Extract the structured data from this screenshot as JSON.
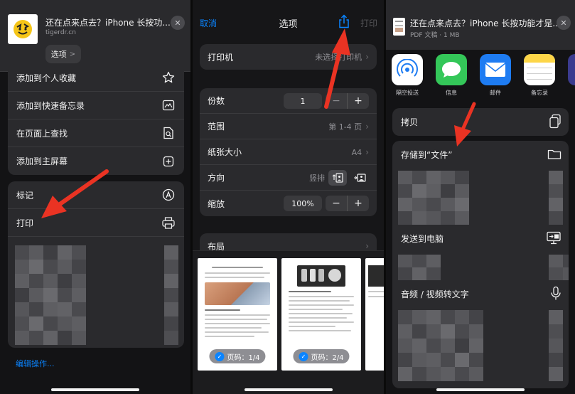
{
  "panel1": {
    "site_title": "还在点来点去？iPhone 长按功...",
    "site_url": "tigerdr.cn",
    "options_label": "选项",
    "options_chevron": ">",
    "close_glyph": "✕",
    "menu_top": [
      {
        "label": "添加到个人收藏",
        "icon": "star-icon"
      },
      {
        "label": "添加到快速备忘录",
        "icon": "quick-note-icon"
      },
      {
        "label": "在页面上查找",
        "icon": "find-in-page-icon"
      },
      {
        "label": "添加到主屏幕",
        "icon": "add-square-icon"
      }
    ],
    "menu_bottom": [
      {
        "label": "标记",
        "icon": "markup-icon"
      },
      {
        "label": "打印",
        "icon": "printer-icon"
      }
    ],
    "edit_actions": "编辑操作..."
  },
  "panel2": {
    "cancel": "取消",
    "title": "选项",
    "print": "打印",
    "printer": {
      "label": "打印机",
      "value": "未选择打印机"
    },
    "copies": {
      "label": "份数",
      "value": "1",
      "minus": "−",
      "plus": "+"
    },
    "range": {
      "label": "范围",
      "value": "第 1-4 页"
    },
    "paper": {
      "label": "纸张大小",
      "value": "A4"
    },
    "orientation": {
      "label": "方向",
      "value": "竖排"
    },
    "scale": {
      "label": "缩放",
      "value": "100%",
      "minus": "−",
      "plus": "+"
    },
    "layout": {
      "label": "布局"
    },
    "chevron": "›",
    "pages": [
      {
        "pill": "页码：1/4"
      },
      {
        "pill": "页码：2/4"
      }
    ],
    "check_glyph": "✓"
  },
  "panel3": {
    "doc_title": "还在点来点去？iPhone 长按功能才是...",
    "doc_sub": "PDF 文稿 · 1 MB",
    "close_glyph": "✕",
    "apps": [
      {
        "label": "隔空投送",
        "icon": "airdrop-icon",
        "color": "#ffffff"
      },
      {
        "label": "信息",
        "icon": "messages-icon",
        "color": "#34c759"
      },
      {
        "label": "邮件",
        "icon": "mail-icon",
        "color": "#1e7cf2"
      },
      {
        "label": "备忘录",
        "icon": "notes-icon",
        "color": "#ffffff"
      }
    ],
    "copy": "拷贝",
    "save_to_files": "存储到“文件”",
    "send_to_pc": "发送到电脑",
    "audio_to_text": "音频 / 视频转文字"
  },
  "colors": {
    "accent": "#0a84ff",
    "annotation_arrow": "#ea3323"
  }
}
